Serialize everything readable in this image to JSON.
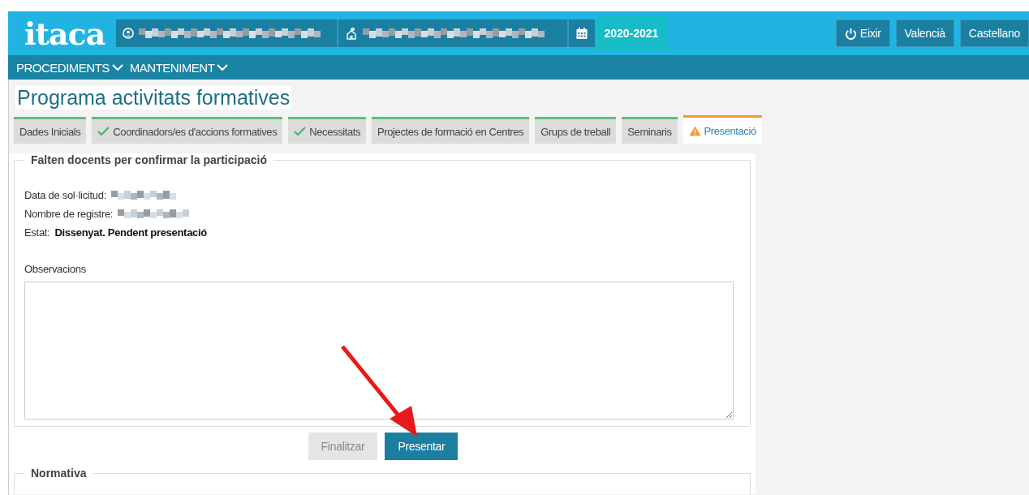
{
  "header": {
    "logo": "itaca",
    "year": "2020-2021",
    "buttons": [
      {
        "label": "Eixir",
        "kind": "power"
      },
      {
        "label": "Valencià",
        "kind": "plain"
      },
      {
        "label": "Castellano",
        "kind": "plain"
      }
    ]
  },
  "menu": [
    {
      "label": "PROCEDIMENTS"
    },
    {
      "label": "MANTENIMENT"
    }
  ],
  "page_title": "Programa activitats formatives",
  "tabs": [
    {
      "label": "Dades Inicials",
      "kind": "plain",
      "selected": false
    },
    {
      "label": "Coordinadors/es d'accions formatives",
      "kind": "done",
      "selected": false
    },
    {
      "label": "Necessitats",
      "kind": "done",
      "selected": false
    },
    {
      "label": "Projectes de formació en Centres",
      "kind": "plain",
      "selected": false
    },
    {
      "label": "Grups de treball",
      "kind": "plain",
      "selected": false
    },
    {
      "label": "Seminaris",
      "kind": "plain",
      "selected": false
    },
    {
      "label": "Presentació",
      "kind": "warning",
      "selected": true
    }
  ],
  "form": {
    "legend": "Falten docents per confirmar la participació",
    "fields": [
      {
        "label": "Data de sol·licitud:",
        "kind": "redacted"
      },
      {
        "label": "Nombre de registre:",
        "kind": "redacted"
      },
      {
        "label": "Estat:",
        "kind": "text",
        "value": "Dissenyat. Pendent presentació"
      }
    ],
    "observations_label": "Observacions"
  },
  "buttons": [
    {
      "label": "Finalitzar",
      "disabled": true
    },
    {
      "label": "Presentar",
      "disabled": false
    }
  ],
  "section_2": {
    "legend": "Normativa"
  }
}
